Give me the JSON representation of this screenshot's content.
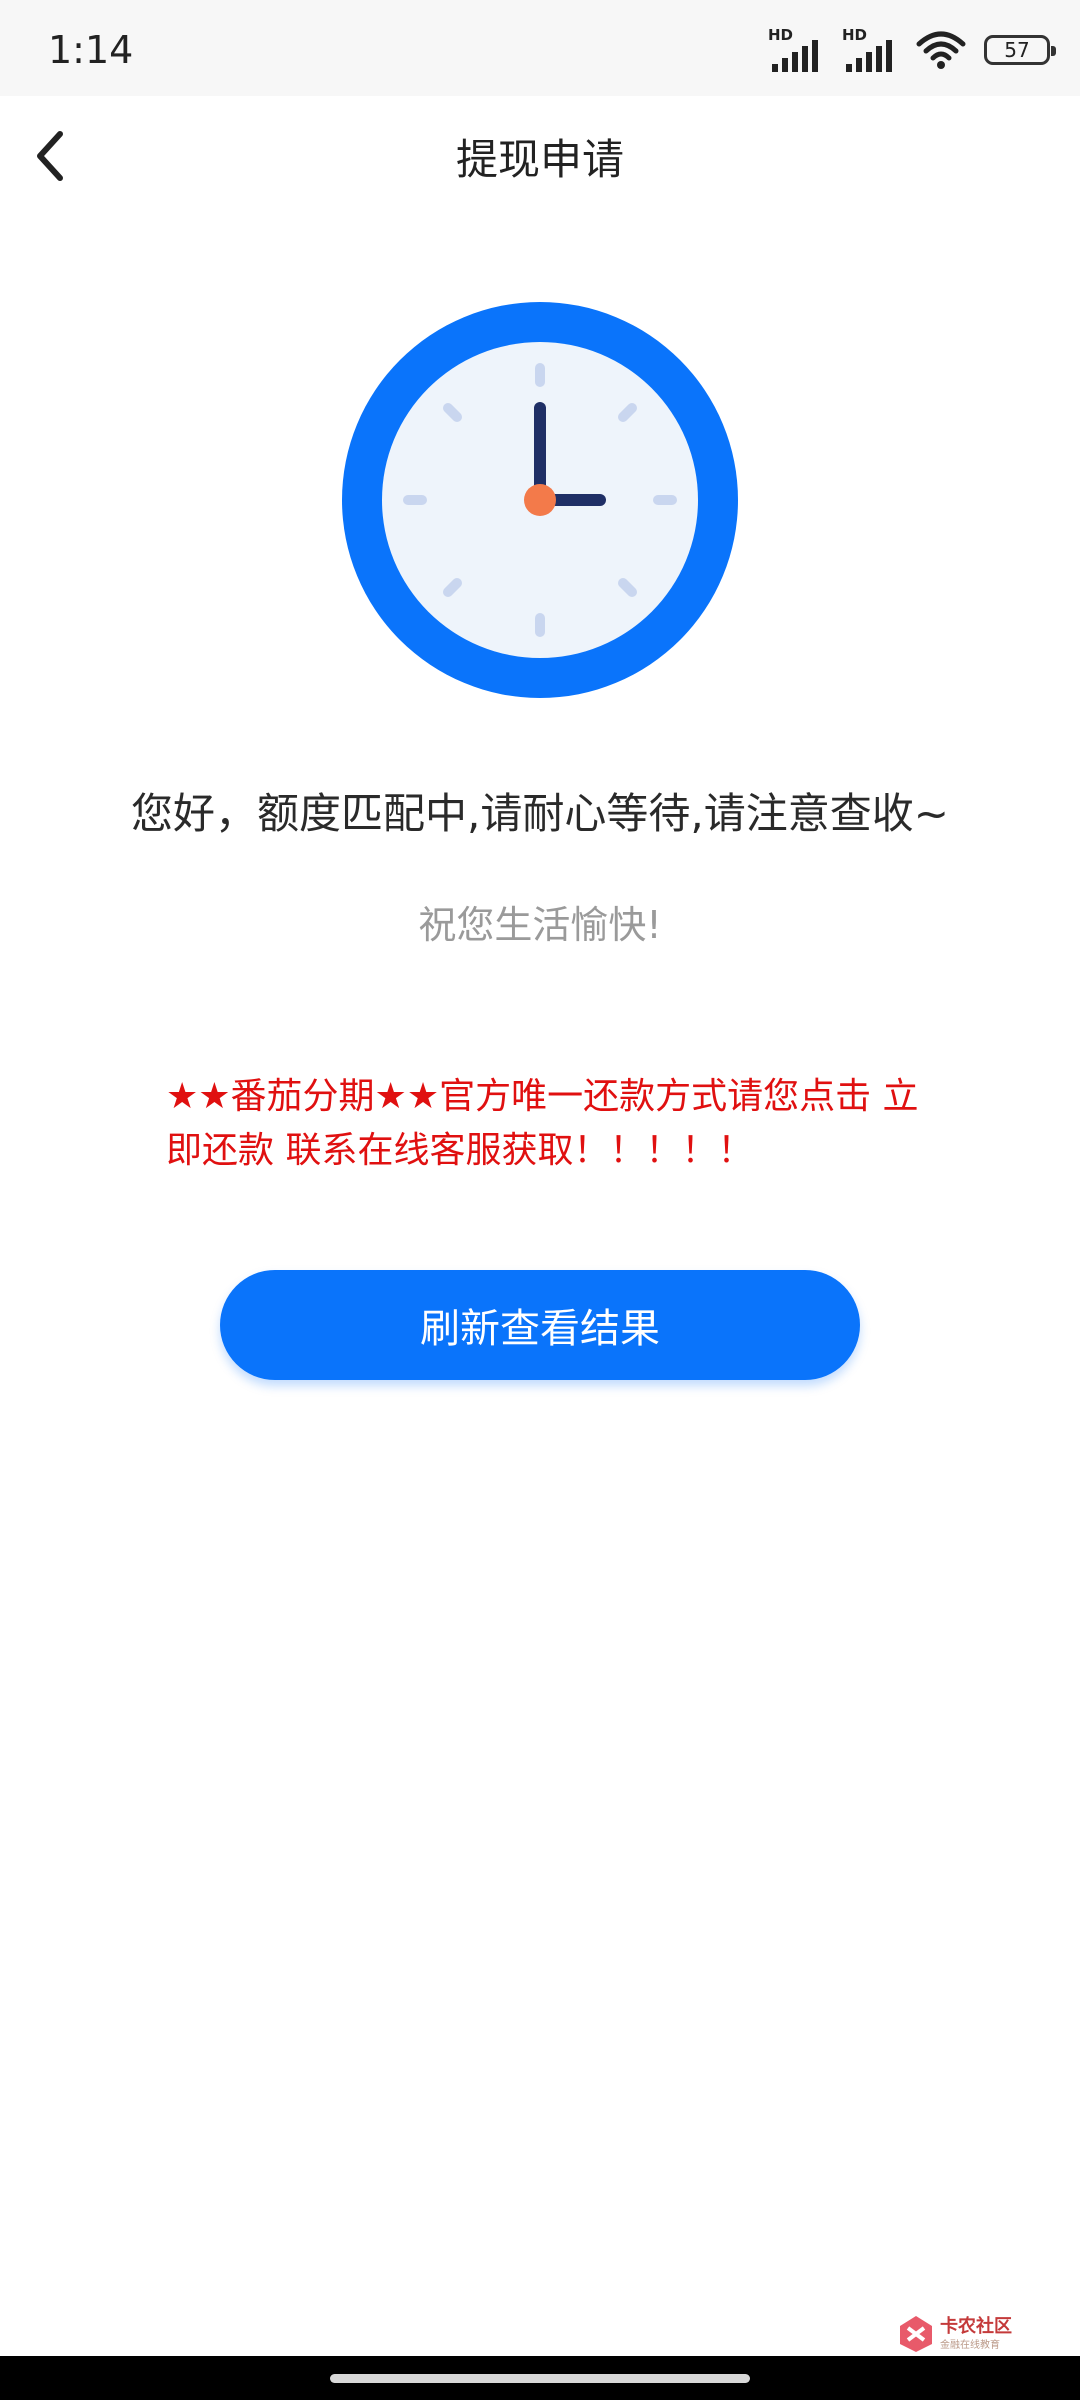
{
  "status_bar": {
    "time": "1:14",
    "signal_label_1": "HD",
    "signal_label_2": "HD",
    "battery": "57"
  },
  "header": {
    "title": "提现申请",
    "back_icon": "chevron-left-icon"
  },
  "clock": {
    "icon": "clock-icon",
    "ring_color": "#0a74fb",
    "face_color": "#eef4fb",
    "hand_color": "#1f2f66",
    "center_color": "#f37a4a"
  },
  "messages": {
    "main": "您好，额度匹配中,请耐心等待,请注意查收~",
    "sub": "祝您生活愉快!",
    "notice": "★★番茄分期★★官方唯一还款方式请您点击 立即还款 联系在线客服获取！！！！！"
  },
  "actions": {
    "refresh_label": "刷新查看结果"
  },
  "watermark": {
    "title": "卡农社区",
    "subtitle": "金融在线教育"
  },
  "colors": {
    "accent": "#0a74fb",
    "notice": "#e01010"
  }
}
